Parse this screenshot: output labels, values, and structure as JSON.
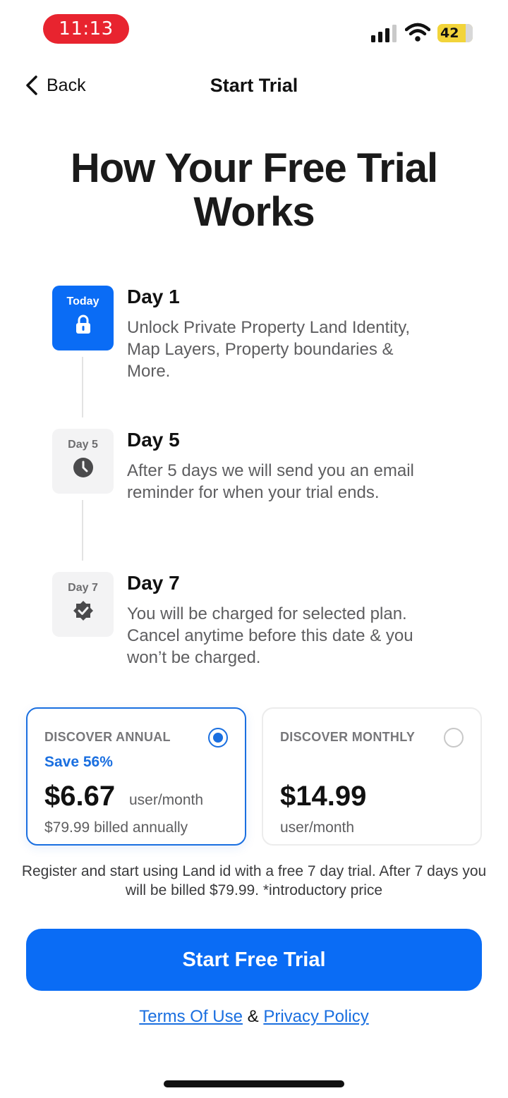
{
  "status_bar": {
    "time": "11:13",
    "battery": "42"
  },
  "nav": {
    "back_label": "Back",
    "title": "Start Trial"
  },
  "headline": "How Your Free Trial Works",
  "steps": [
    {
      "tag": "Today",
      "title": "Day 1",
      "description": "Unlock Private Property Land Identity, Map Layers, Property boundaries & More.",
      "icon": "lock-icon"
    },
    {
      "tag": "Day 5",
      "title": "Day 5",
      "description": "After 5 days we will send you an email reminder for when your trial ends.",
      "icon": "clock-icon"
    },
    {
      "tag": "Day 7",
      "title": "Day 7",
      "description": "You will be charged for selected plan. Cancel anytime before this date & you won’t be charged.",
      "icon": "verified-badge-icon"
    }
  ],
  "plans": {
    "annual": {
      "name": "DISCOVER ANNUAL",
      "save": "Save 56%",
      "price": "$6.67",
      "per": "user/month",
      "billed": "$79.99 billed annually",
      "selected": true
    },
    "monthly": {
      "name": "DISCOVER MONTHLY",
      "price": "$14.99",
      "per": "user/month",
      "selected": false
    }
  },
  "note": "Register and start using Land id with a free 7 day trial. After 7 days you will be billed $79.99. *introductory price",
  "cta_label": "Start Free Trial",
  "links": {
    "terms": "Terms Of Use",
    "separator": "&",
    "privacy": "Privacy Policy"
  },
  "colors": {
    "accent": "#0a6cf5",
    "time_pill": "#e8242f",
    "battery": "#f2d43a"
  }
}
